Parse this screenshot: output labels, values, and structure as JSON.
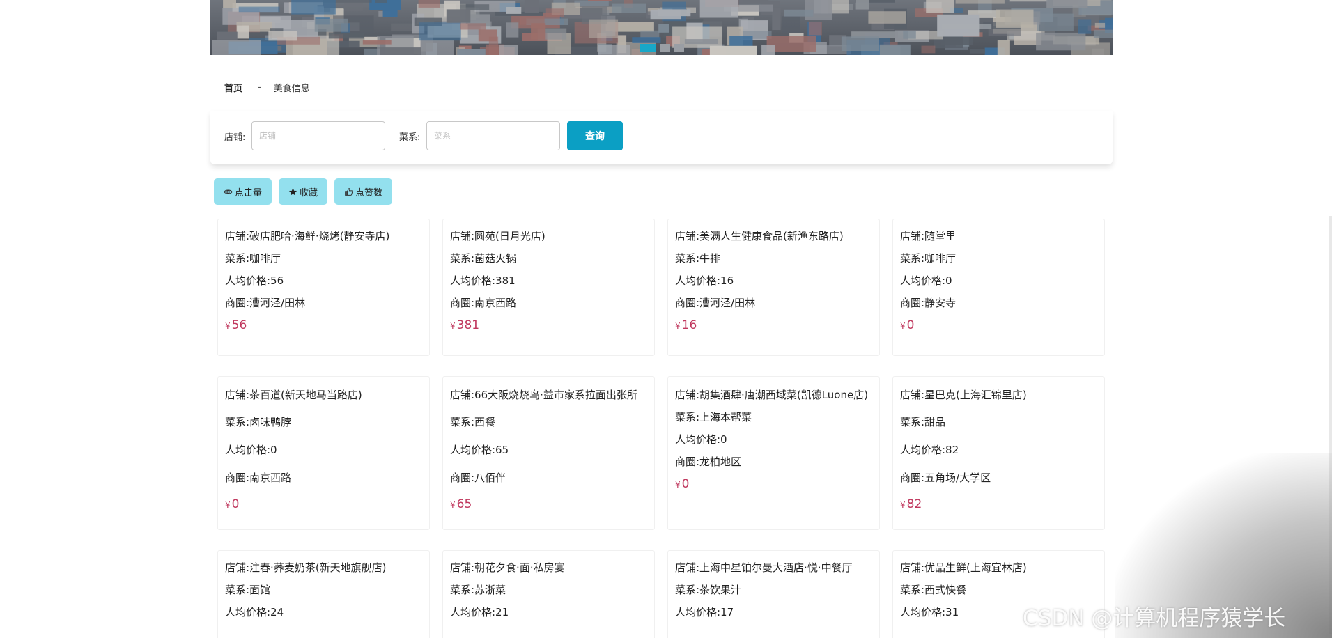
{
  "breadcrumb": {
    "home": "首页",
    "separator": "-",
    "current": "美食信息"
  },
  "search": {
    "shop_label": "店铺:",
    "shop_placeholder": "店铺",
    "cuisine_label": "菜系:",
    "cuisine_placeholder": "菜系",
    "button_label": "查询"
  },
  "sort_buttons": [
    {
      "label": "点击量",
      "icon": "eye-icon"
    },
    {
      "label": "收藏",
      "icon": "star-icon"
    },
    {
      "label": "点赞数",
      "icon": "thumbs-up-icon"
    }
  ],
  "carousel": {
    "slides": 3,
    "active_index": 0
  },
  "cards": [
    {
      "shop": "店铺:破店肥哈·海鲜·烧烤(静安寺店)",
      "cuisine": "菜系:咖啡厅",
      "avg": "人均价格:56",
      "district": "商圈:漕河泾/田林",
      "price": "56"
    },
    {
      "shop": "店铺:圆苑(日月光店)",
      "cuisine": "菜系:菌菇火锅",
      "avg": "人均价格:381",
      "district": "商圈:南京西路",
      "price": "381"
    },
    {
      "shop": "店铺:美满人生健康食品(新渔东路店)",
      "cuisine": "菜系:牛排",
      "avg": "人均价格:16",
      "district": "商圈:漕河泾/田林",
      "price": "16"
    },
    {
      "shop": "店铺:随堂里",
      "cuisine": "菜系:咖啡厅",
      "avg": "人均价格:0",
      "district": "商圈:静安寺",
      "price": "0"
    },
    {
      "shop": "店铺:茶百道(新天地马当路店)",
      "cuisine": "菜系:卤味鸭脖",
      "avg": "人均价格:0",
      "district": "商圈:南京西路",
      "price": "0"
    },
    {
      "shop": "店铺:66大阪烧烧鸟·益市家系拉面出张所",
      "cuisine": "菜系:西餐",
      "avg": "人均价格:65",
      "district": "商圈:八佰伴",
      "price": "65"
    },
    {
      "shop": "店铺:胡集酒肆·唐潮西域菜(凯德Luone店)",
      "cuisine": "菜系:上海本帮菜",
      "avg": "人均价格:0",
      "district": "商圈:龙柏地区",
      "price": "0"
    },
    {
      "shop": "店铺:星巴克(上海汇锦里店)",
      "cuisine": "菜系:甜品",
      "avg": "人均价格:82",
      "district": "商圈:五角场/大学区",
      "price": "82"
    },
    {
      "shop": "店铺:注春·荞麦奶茶(新天地旗舰店)",
      "cuisine": "菜系:面馆",
      "avg": "人均价格:24",
      "district": "",
      "price": ""
    },
    {
      "shop": "店铺:朝花夕食·面·私房宴",
      "cuisine": "菜系:苏浙菜",
      "avg": "人均价格:21",
      "district": "",
      "price": ""
    },
    {
      "shop": "店铺:上海中星铂尔曼大酒店·悦·中餐厅",
      "cuisine": "菜系:茶饮果汁",
      "avg": "人均价格:17",
      "district": "",
      "price": ""
    },
    {
      "shop": "店铺:优品生鲜(上海宜林店)",
      "cuisine": "菜系:西式快餐",
      "avg": "人均价格:31",
      "district": "",
      "price": ""
    }
  ],
  "currency_symbol": "¥",
  "watermark": "CSDN @计算机程序猿学长",
  "colors": {
    "primary": "#0b9fc4",
    "sort_button_bg": "#93e0ee",
    "price": "#c0385e",
    "carousel_active": "#19a7c8"
  }
}
